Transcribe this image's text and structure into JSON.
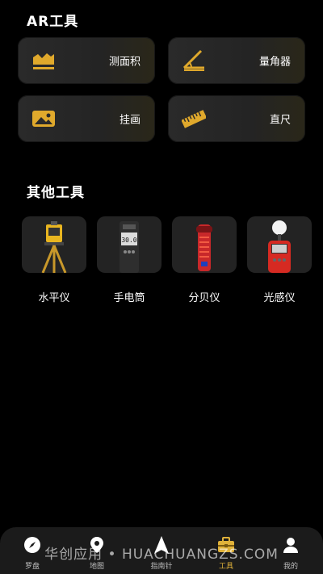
{
  "ar_section": {
    "title": "AR工具",
    "cards": [
      {
        "label": "测面积",
        "icon": "area-measure-icon"
      },
      {
        "label": "量角器",
        "icon": "protractor-icon"
      },
      {
        "label": "挂画",
        "icon": "picture-hang-icon"
      },
      {
        "label": "直尺",
        "icon": "ruler-icon"
      }
    ]
  },
  "other_section": {
    "title": "其他工具",
    "tools": [
      {
        "label": "水平仪",
        "icon": "level-instrument-icon"
      },
      {
        "label": "手电筒",
        "icon": "flashlight-icon"
      },
      {
        "label": "分贝仪",
        "icon": "decibel-meter-icon"
      },
      {
        "label": "光感仪",
        "icon": "light-meter-icon"
      }
    ]
  },
  "tabbar": {
    "items": [
      {
        "label": "罗盘",
        "icon": "compass-icon",
        "active": false
      },
      {
        "label": "地图",
        "icon": "map-pin-icon",
        "active": false
      },
      {
        "label": "指南针",
        "icon": "navigation-arrow-icon",
        "active": false
      },
      {
        "label": "工具",
        "icon": "toolbox-icon",
        "active": true
      },
      {
        "label": "我的",
        "icon": "profile-icon",
        "active": false
      }
    ]
  },
  "watermark": "华创应用 • HUACHUANGZS.COM",
  "colors": {
    "accent": "#e0b23a",
    "card_bg": "#262626",
    "background": "#000000"
  }
}
